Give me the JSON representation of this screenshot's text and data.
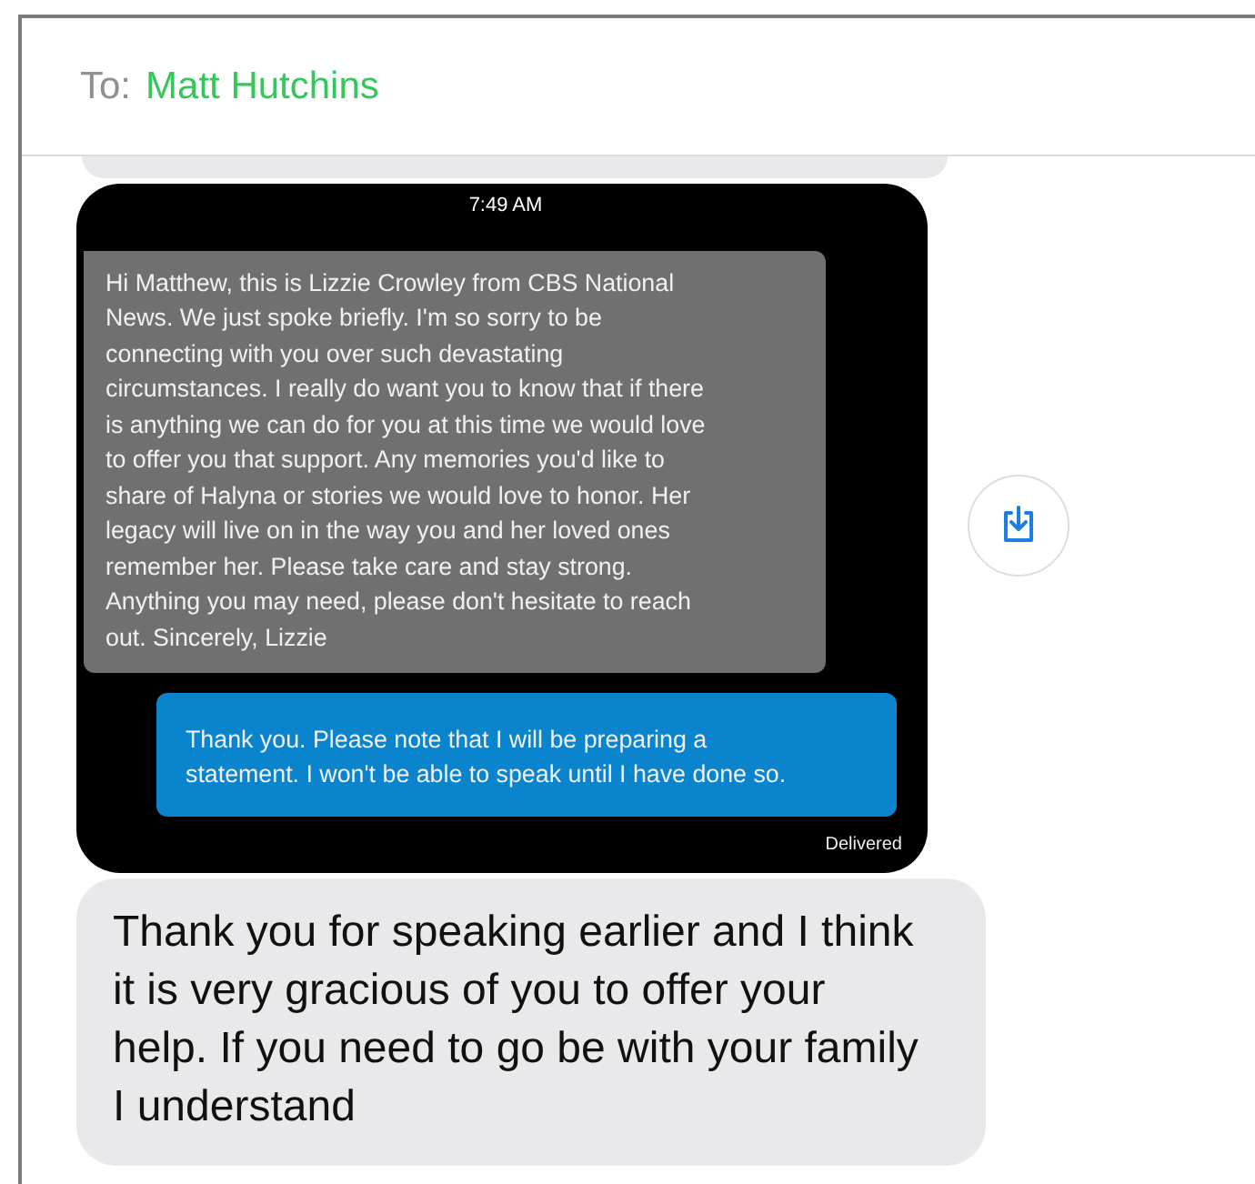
{
  "header": {
    "to_label": "To:",
    "recipient": "Matt Hutchins"
  },
  "messages": [
    {
      "kind": "partial",
      "sent": false
    },
    {
      "kind": "screenshot",
      "sent": false,
      "time": "7:49 AM",
      "status": "Delivered",
      "messages": [
        {
          "sent": false,
          "text": "Hi Matthew, this is Lizzie Crowley from CBS National News. We just spoke briefly. I'm so sorry to be connecting with you over such devastating circumstances. I really do want you to know that if there is anything we can do for you at this time we would love to offer you that support. Any memories you'd like to share of Halyna or stories we would love to honor. Her legacy will live on in the way you and her loved ones remember her. Please take care and stay strong. Anything you may need, please don't hesitate to reach out. Sincerely, Lizzie"
        },
        {
          "sent": true,
          "text": "Thank you. Please note that I will be preparing a statement. I won't be able to speak until I have done so."
        }
      ]
    },
    {
      "kind": "text",
      "sent": false,
      "text": "Thank you for speaking earlier and I think it is very gracious of you to offer your help. If you need to go be with your family I understand"
    }
  ]
}
